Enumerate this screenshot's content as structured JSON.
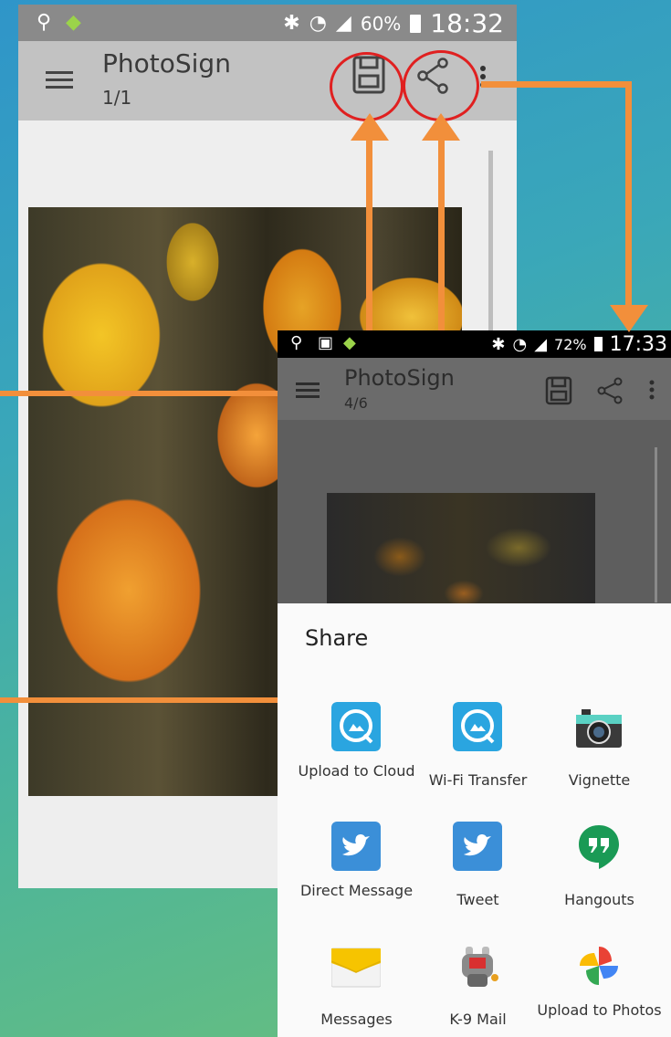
{
  "back_screen": {
    "status": {
      "battery": "60%",
      "time": "18:32"
    },
    "title": "PhotoSign",
    "subtitle": "1/1"
  },
  "front_screen": {
    "status": {
      "battery": "72%",
      "time": "17:33"
    },
    "title": "PhotoSign",
    "subtitle": "4/6",
    "share": {
      "title": "Share",
      "items": [
        {
          "label": "Upload to Cloud",
          "icon": "cloud-upload-icon"
        },
        {
          "label": "Wi-Fi Transfer",
          "icon": "wifi-transfer-icon"
        },
        {
          "label": "Vignette",
          "icon": "camera-icon"
        },
        {
          "label": "Direct Message",
          "icon": "twitter-icon"
        },
        {
          "label": "Tweet",
          "icon": "twitter-icon"
        },
        {
          "label": "Hangouts",
          "icon": "hangouts-icon"
        },
        {
          "label": "Messages",
          "icon": "envelope-icon"
        },
        {
          "label": "K-9 Mail",
          "icon": "k9-mail-icon"
        },
        {
          "label": "Upload to Photos",
          "icon": "photos-pinwheel-icon"
        }
      ]
    }
  },
  "colors": {
    "annotation_circle": "#e02020",
    "arrow": "#f28f3b",
    "twitter": "#3b8fd8",
    "hangouts": "#1a9a55"
  }
}
